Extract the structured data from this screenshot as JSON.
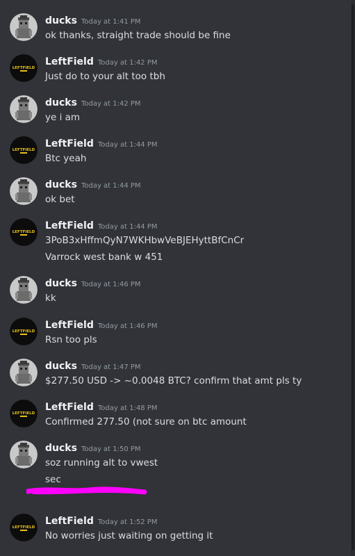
{
  "messages": [
    {
      "author": "ducks",
      "avatar": "ducks-avatar-icon",
      "time": "Today at 1:41 PM",
      "lines": [
        "ok thanks, straight trade should be fine"
      ]
    },
    {
      "author": "LeftField",
      "avatar": "leftfield-logo-icon",
      "time": "Today at 1:42 PM",
      "lines": [
        "Just do to your alt too tbh"
      ]
    },
    {
      "author": "ducks",
      "avatar": "ducks-avatar-icon",
      "time": "Today at 1:42 PM",
      "lines": [
        "ye i am"
      ]
    },
    {
      "author": "LeftField",
      "avatar": "leftfield-logo-icon",
      "time": "Today at 1:44 PM",
      "lines": [
        "Btc yeah"
      ]
    },
    {
      "author": "ducks",
      "avatar": "ducks-avatar-icon",
      "time": "Today at 1:44 PM",
      "lines": [
        "ok bet"
      ]
    },
    {
      "author": "LeftField",
      "avatar": "leftfield-logo-icon",
      "time": "Today at 1:44 PM",
      "lines": [
        "3PoB3xHffmQyN7WKHbwVeBJEHyttBfCnCr",
        "Varrock west bank w 451"
      ]
    },
    {
      "author": "ducks",
      "avatar": "ducks-avatar-icon",
      "time": "Today at 1:46 PM",
      "lines": [
        "kk"
      ]
    },
    {
      "author": "LeftField",
      "avatar": "leftfield-logo-icon",
      "time": "Today at 1:46 PM",
      "lines": [
        "Rsn too pls"
      ]
    },
    {
      "author": "ducks",
      "avatar": "ducks-avatar-icon",
      "time": "Today at 1:47 PM",
      "lines": [
        "$277.50 USD -> ~0.0048 BTC? confirm that amt pls ty"
      ]
    },
    {
      "author": "LeftField",
      "avatar": "leftfield-logo-icon",
      "time": "Today at 1:48 PM",
      "lines": [
        "Confirmed 277.50 (not sure on btc amount"
      ]
    },
    {
      "author": "ducks",
      "avatar": "ducks-avatar-icon",
      "time": "Today at 1:50 PM",
      "lines": [
        "soz running alt to vwest",
        "sec"
      ]
    },
    {
      "author": "LeftField",
      "avatar": "leftfield-logo-icon",
      "time": "Today at 1:52 PM",
      "lines": [
        "No worries just waiting on getting it"
      ]
    }
  ],
  "logo_text": "LEFTFIELD",
  "colors": {
    "background": "#313338",
    "redaction": "#ff00ff",
    "author": "#f2f3f5",
    "timestamp": "#949ba4",
    "text": "#dbdee1"
  }
}
